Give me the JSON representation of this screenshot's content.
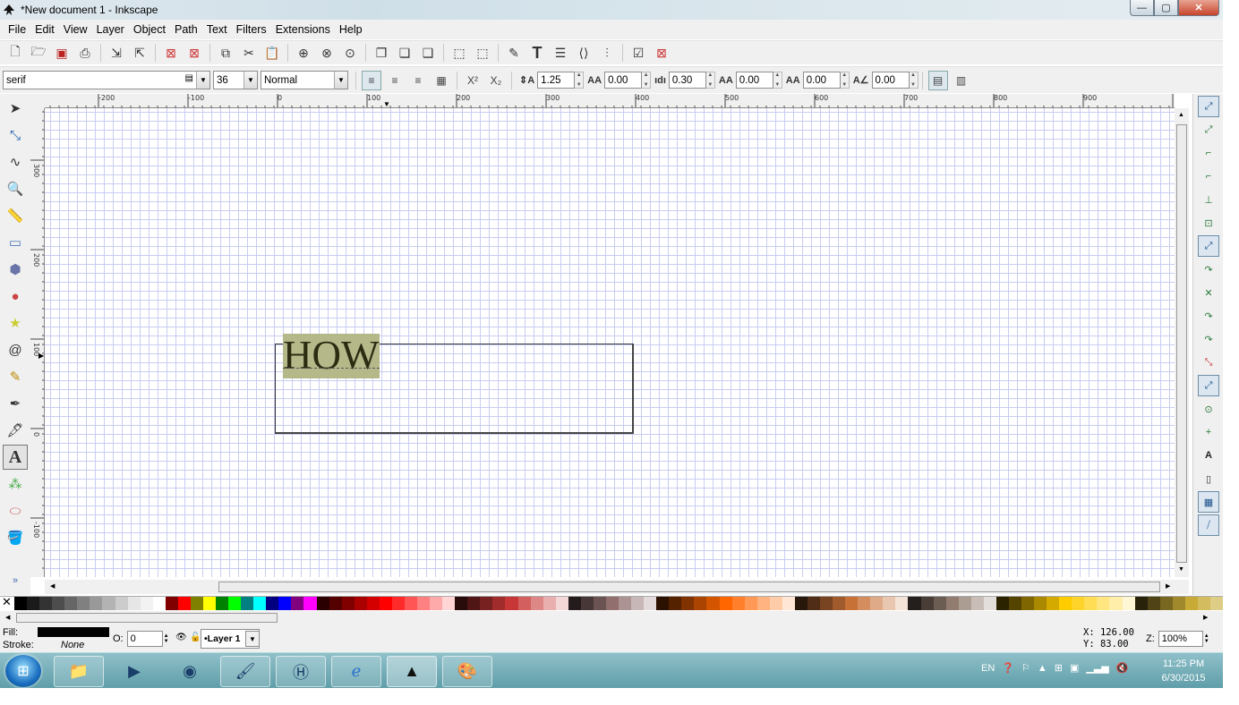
{
  "window": {
    "title": "*New document 1 - Inkscape",
    "btn_min": "—",
    "btn_max": "▢",
    "btn_close": "✕"
  },
  "menu": [
    "File",
    "Edit",
    "View",
    "Layer",
    "Object",
    "Path",
    "Text",
    "Filters",
    "Extensions",
    "Help"
  ],
  "text_toolbar": {
    "font_family": "serif",
    "font_size": "36",
    "font_style": "Normal",
    "line_spacing": "1.25",
    "letter_spacing": "0.00",
    "word_spacing": "0.30",
    "horizontal_kerning": "0.00",
    "vertical_shift": "0.00",
    "rotation": "0.00"
  },
  "rulers": {
    "top": [
      "-200",
      "-100",
      "0",
      "100",
      "200",
      "300",
      "400",
      "500",
      "600",
      "700",
      "800",
      "900"
    ],
    "left": [
      "300",
      "200",
      "100",
      "0",
      "-100"
    ]
  },
  "canvas": {
    "text_content": "HOW"
  },
  "palette_colors": [
    "#000000",
    "#1a1a1a",
    "#333333",
    "#4d4d4d",
    "#666666",
    "#808080",
    "#999999",
    "#b3b3b3",
    "#cccccc",
    "#e6e6e6",
    "#f2f2f2",
    "#ffffff",
    "#800000",
    "#ff0000",
    "#808000",
    "#ffff00",
    "#008000",
    "#00ff00",
    "#008080",
    "#00ffff",
    "#000080",
    "#0000ff",
    "#800080",
    "#ff00ff",
    "#2b0000",
    "#550000",
    "#800000",
    "#aa0000",
    "#d40000",
    "#ff0000",
    "#ff2a2a",
    "#ff5555",
    "#ff8080",
    "#ffaaaa",
    "#ffd5d5",
    "#280b0b",
    "#501616",
    "#782121",
    "#a02c2c",
    "#c83737",
    "#d35f5f",
    "#de8787",
    "#e9afaf",
    "#f4d7d7",
    "#241c1c",
    "#483737",
    "#6c5353",
    "#916f6f",
    "#ac9393",
    "#c8b7b7",
    "#e3dbdb",
    "#2b1100",
    "#552200",
    "#803300",
    "#aa4400",
    "#d45500",
    "#ff6600",
    "#ff7f2a",
    "#ff9955",
    "#ffb380",
    "#ffccaa",
    "#ffe6d5",
    "#28170b",
    "#502d16",
    "#784421",
    "#a05a2c",
    "#c87137",
    "#d38d5f",
    "#deaa87",
    "#e9c6af",
    "#f4e3d7",
    "#241f1c",
    "#483e37",
    "#6c5d53",
    "#917c6f",
    "#ac9d93",
    "#c8beb7",
    "#e3dedb",
    "#2b2200",
    "#554400",
    "#806600",
    "#aa8800",
    "#d4aa00",
    "#ffcc00",
    "#ffd42a",
    "#ffdd55",
    "#ffe680",
    "#ffeeaa",
    "#fff6d5",
    "#28220b",
    "#504416",
    "#786721",
    "#a0892c",
    "#c8ab37",
    "#d3bc5f",
    "#decd87"
  ],
  "status": {
    "fill_label": "Fill:",
    "stroke_label": "Stroke:",
    "stroke_value": "None",
    "opacity_label": "O:",
    "opacity_value": "0",
    "layer": "•Layer 1",
    "x_label": "X:",
    "x_value": "126.00",
    "y_label": "Y:",
    "y_value": "83.00",
    "zoom_label": "Z:",
    "zoom_value": "100%"
  },
  "taskbar": {
    "lang": "EN",
    "time": "11:25 PM",
    "date": "6/30/2015"
  }
}
